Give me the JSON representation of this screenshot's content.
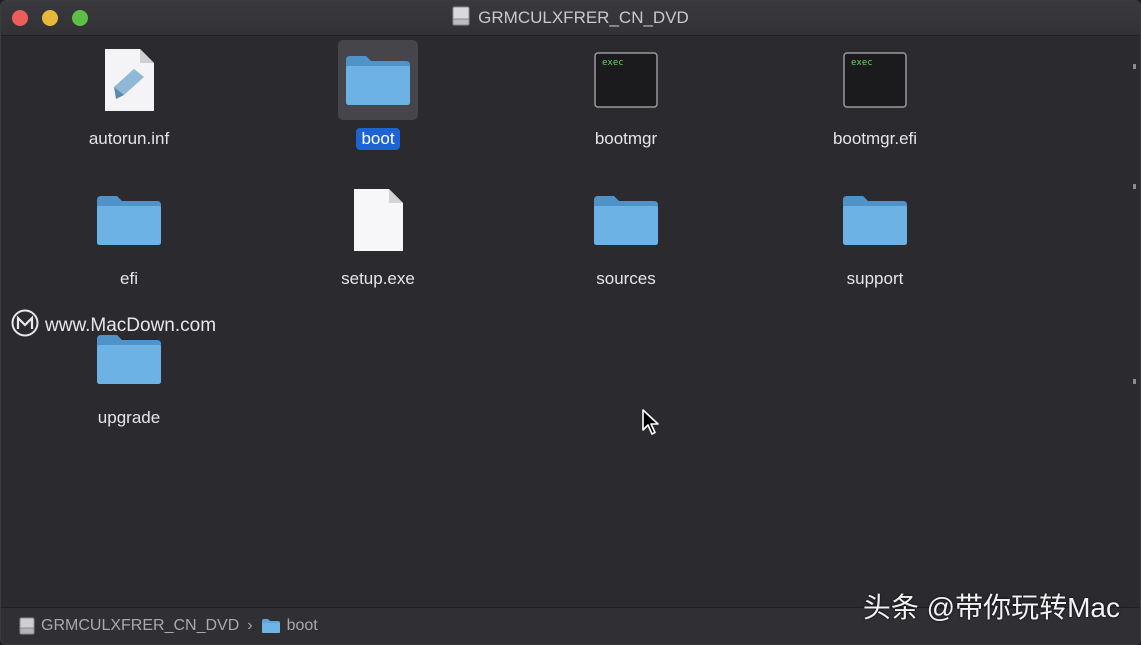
{
  "window": {
    "title": "GRMCULXFRER_CN_DVD",
    "title_icon": "disk-icon"
  },
  "files": [
    {
      "name": "autorun.inf",
      "kind": "document",
      "icon": "inf-file-icon",
      "selected": false
    },
    {
      "name": "boot",
      "kind": "folder",
      "icon": "folder-icon",
      "selected": true
    },
    {
      "name": "bootmgr",
      "kind": "exec",
      "icon": "exec-file-icon",
      "badge": "exec",
      "selected": false
    },
    {
      "name": "bootmgr.efi",
      "kind": "exec",
      "icon": "exec-file-icon",
      "badge": "exec",
      "selected": false
    },
    {
      "name": "efi",
      "kind": "folder",
      "icon": "folder-icon",
      "selected": false
    },
    {
      "name": "setup.exe",
      "kind": "blank",
      "icon": "blank-file-icon",
      "selected": false
    },
    {
      "name": "sources",
      "kind": "folder",
      "icon": "folder-icon",
      "selected": false
    },
    {
      "name": "support",
      "kind": "folder",
      "icon": "folder-icon",
      "selected": false
    },
    {
      "name": "upgrade",
      "kind": "folder",
      "icon": "folder-icon",
      "selected": false
    }
  ],
  "watermark": {
    "text": "www.MacDown.com",
    "icon": "macdown-logo-icon"
  },
  "pathbar": {
    "segments": [
      "GRMCULXFRER_CN_DVD",
      "boot"
    ],
    "separator": "›"
  },
  "credit": "头条 @带你玩转Mac",
  "colors": {
    "selection": "#1e63d4",
    "folder": "#5fa5d8",
    "background": "#2b2a2f"
  }
}
